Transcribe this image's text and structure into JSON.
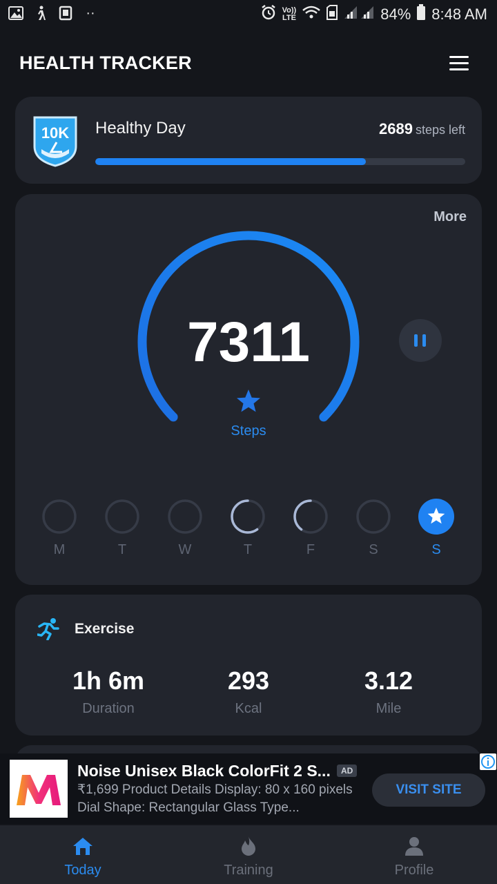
{
  "status_bar": {
    "volte_top": "Vo))",
    "volte_bottom": "LTE",
    "battery": "84%",
    "time": "8:48 AM"
  },
  "header": {
    "title": "HEALTH TRACKER"
  },
  "goal": {
    "badge_text": "10K",
    "name": "Healthy Day",
    "steps_left_value": "2689",
    "steps_left_label": "steps left",
    "progress_fraction": 0.731
  },
  "steps": {
    "more_label": "More",
    "value": "7311",
    "label": "Steps",
    "ring_fraction": 0.731
  },
  "week": {
    "days": [
      {
        "label": "M",
        "progress": 0,
        "goal_met": false
      },
      {
        "label": "T",
        "progress": 0,
        "goal_met": false
      },
      {
        "label": "W",
        "progress": 0,
        "goal_met": false
      },
      {
        "label": "T",
        "progress": 0.6,
        "goal_met": false
      },
      {
        "label": "F",
        "progress": 0.4,
        "goal_met": false
      },
      {
        "label": "S",
        "progress": 0,
        "goal_met": false
      },
      {
        "label": "S",
        "progress": 1,
        "goal_met": true,
        "active": true
      }
    ]
  },
  "exercise": {
    "title": "Exercise",
    "stats": [
      {
        "value": "1h 6m",
        "label": "Duration"
      },
      {
        "value": "293",
        "label": "Kcal"
      },
      {
        "value": "3.12",
        "label": "Mile"
      }
    ]
  },
  "ad": {
    "title": "Noise Unisex Black ColorFit 2 S...",
    "tag": "AD",
    "description": "₹1,699 Product Details Display: 80 x 160 pixels Dial Shape: Rectangular Glass Type...",
    "cta": "VISIT SITE"
  },
  "nav": {
    "items": [
      {
        "label": "Today",
        "icon": "home-icon",
        "active": true
      },
      {
        "label": "Training",
        "icon": "flame-icon",
        "active": false
      },
      {
        "label": "Profile",
        "icon": "person-icon",
        "active": false
      }
    ]
  },
  "colors": {
    "accent": "#1f82f2",
    "background": "#14161b",
    "card": "#22252d"
  }
}
